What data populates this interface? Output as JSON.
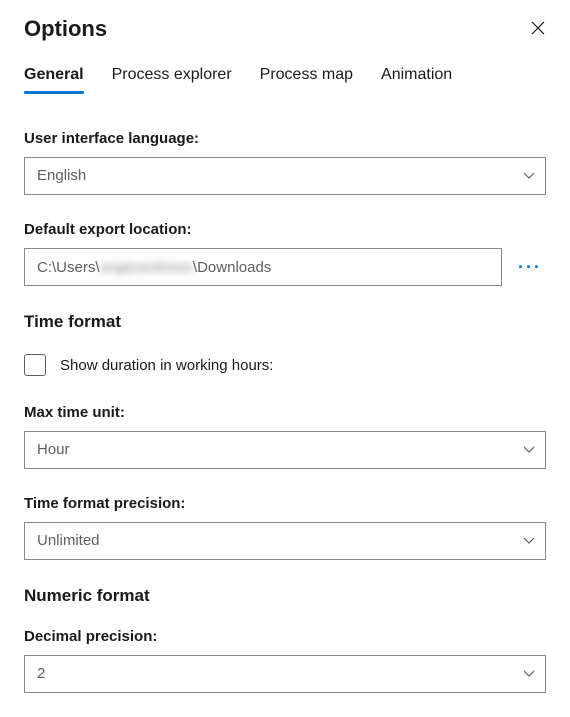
{
  "title": "Options",
  "tabs": [
    {
      "label": "General",
      "active": true
    },
    {
      "label": "Process explorer",
      "active": false
    },
    {
      "label": "Process map",
      "active": false
    },
    {
      "label": "Animation",
      "active": false
    }
  ],
  "ui_language": {
    "label": "User interface language:",
    "value": "English"
  },
  "export_location": {
    "label": "Default export location:",
    "prefix": "C:\\Users\\",
    "redacted": "angieandrews",
    "suffix": "\\Downloads",
    "more_glyph": "···"
  },
  "time_format": {
    "section_title": "Time format",
    "show_duration_label": "Show duration in working hours:",
    "show_duration_checked": false,
    "max_time_unit": {
      "label": "Max time unit:",
      "value": "Hour"
    },
    "precision": {
      "label": "Time format precision:",
      "value": "Unlimited"
    }
  },
  "numeric_format": {
    "section_title": "Numeric format",
    "decimal_precision": {
      "label": "Decimal precision:",
      "value": "2"
    }
  }
}
